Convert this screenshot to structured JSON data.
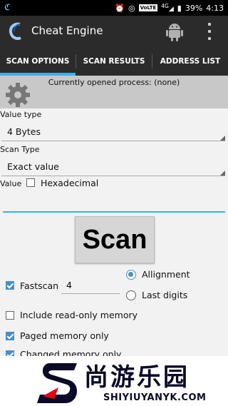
{
  "status_bar": {
    "app_icon": "cheat-engine-icon",
    "volte": "VoLTE",
    "network": "4G",
    "battery": "39%",
    "time": "4:13"
  },
  "app_bar": {
    "title": "Cheat Engine"
  },
  "tabs": [
    {
      "label": "SCAN OPTIONS",
      "active": true
    },
    {
      "label": "SCAN RESULTS",
      "active": false
    },
    {
      "label": "ADDRESS LIST",
      "active": false
    }
  ],
  "process": {
    "text": "Currently opened process: (none)"
  },
  "value_type": {
    "label": "Value type",
    "selected": "4 Bytes"
  },
  "scan_type": {
    "label": "Scan Type",
    "selected": "Exact value"
  },
  "value": {
    "label": "Value",
    "hex_label": "Hexadecimal",
    "hex_checked": false,
    "input": ""
  },
  "scan_button": {
    "label": "Scan"
  },
  "options": {
    "fastscan_label": "Fastscan",
    "fastscan_checked": true,
    "fastscan_value": "4",
    "allignment_label": "Allignment",
    "allignment_selected": true,
    "last_digits_label": "Last digits",
    "last_digits_selected": false,
    "readonly_label": "Include read-only memory",
    "readonly_checked": false,
    "paged_label": "Paged memory only",
    "paged_checked": true,
    "changed_label": "Changed memory only",
    "changed_checked": true
  },
  "banner": {
    "chinese": "尚游乐园",
    "english": "SHIYIUYANYK.COM"
  },
  "colors": {
    "accent": "#33b5e5",
    "appbar": "#2b2b2b",
    "checkbox": "#4a90c8"
  }
}
